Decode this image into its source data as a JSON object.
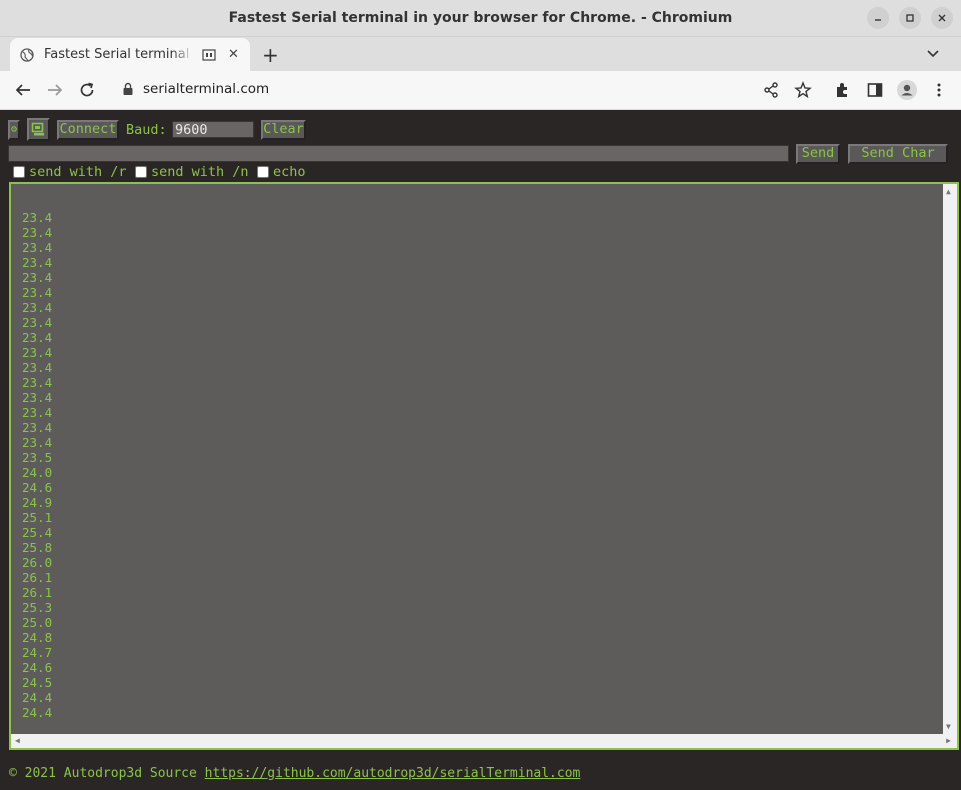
{
  "window": {
    "title": "Fastest Serial terminal in your browser for Chrome. - Chromium"
  },
  "tab": {
    "title": "Fastest Serial terminal in your browser for Chrome."
  },
  "address": {
    "url": "serialterminal.com"
  },
  "controls": {
    "settings_glyph": "⚙",
    "connect_label": "Connect",
    "baud_label": "Baud:",
    "baud_value": "9600",
    "clear_label": "Clear",
    "send_input_value": "",
    "send_label": "Send",
    "send_char_label": "Send Char",
    "opt_r_label": "send with /r",
    "opt_n_label": "send with /n",
    "echo_label": "echo"
  },
  "terminal": {
    "lines": [
      "23.4",
      "23.4",
      "23.4",
      "23.4",
      "23.4",
      "23.4",
      "23.4",
      "23.4",
      "23.4",
      "23.4",
      "23.4",
      "23.4",
      "23.4",
      "23.4",
      "23.4",
      "23.4",
      "23.5",
      "24.0",
      "24.6",
      "24.9",
      "25.1",
      "25.4",
      "25.8",
      "26.0",
      "26.1",
      "26.1",
      "25.3",
      "25.0",
      "24.8",
      "24.7",
      "24.6",
      "24.5",
      "24.4",
      "24.4"
    ]
  },
  "footer": {
    "text": "© 2021 Autodrop3d Source ",
    "link_text": "https://github.com/autodrop3d/serialTerminal.com"
  },
  "colors": {
    "accent": "#8bc34a",
    "page_bg": "#2b2626",
    "terminal_bg": "#5e5c5b"
  }
}
